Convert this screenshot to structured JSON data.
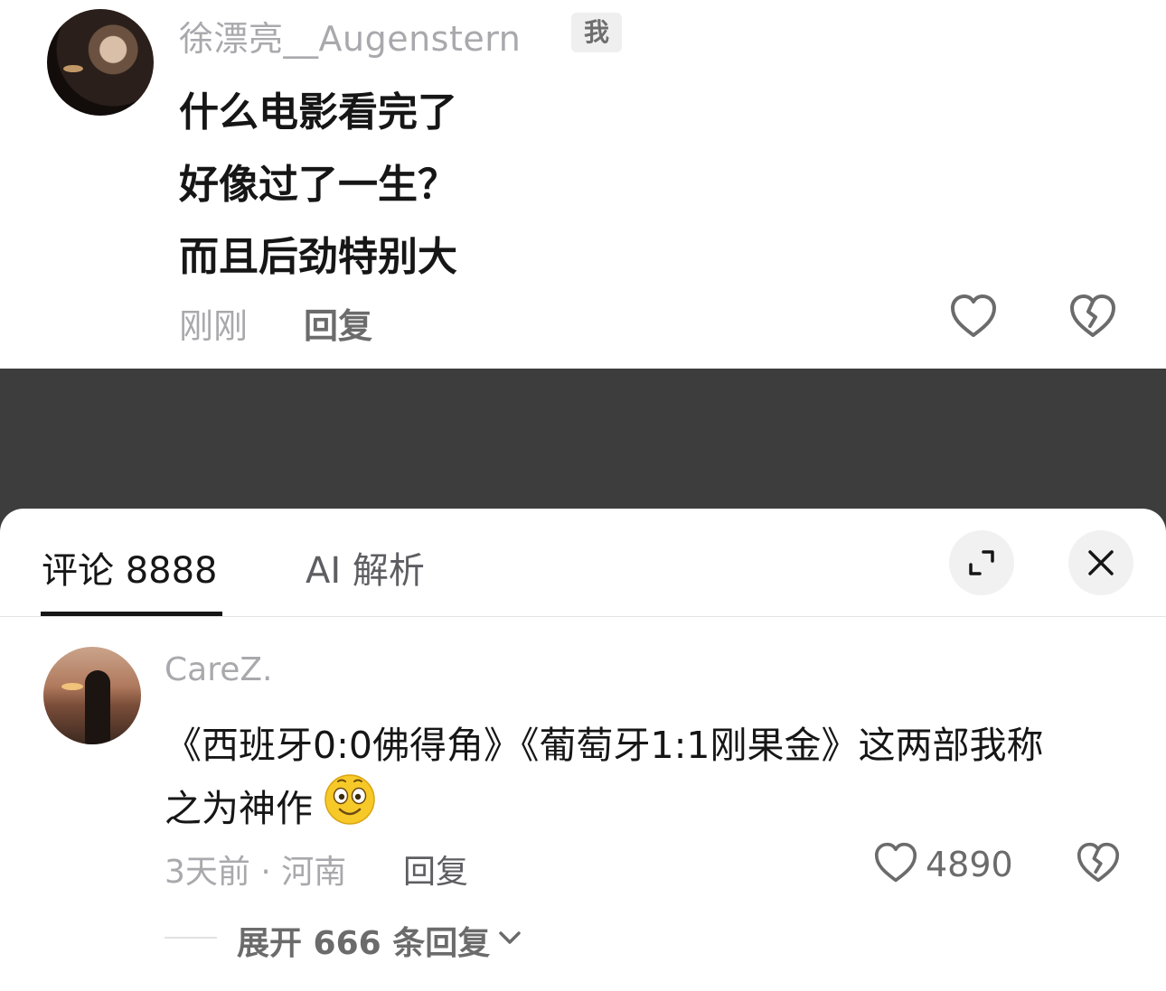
{
  "top_comment": {
    "username": "徐漂亮__Augenstern",
    "badge": "我",
    "lines": [
      "什么电影看完了",
      "好像过了一生？",
      "而且后劲特别大"
    ],
    "time": "刚刚",
    "reply_label": "回复"
  },
  "sheet": {
    "tabs": [
      {
        "label": "评论 8888",
        "active": true
      },
      {
        "label": "AI 解析",
        "active": false
      }
    ],
    "icons": {
      "expand": "expand-icon",
      "close": "close-icon"
    }
  },
  "comment": {
    "username": "CareZ.",
    "text_line1": "《西班牙0:0佛得角》《葡萄牙1:1刚果金》这两部我称",
    "text_line2": "之为神作",
    "emoji": "smiley-emoji",
    "meta": "3天前 · 河南",
    "reply_label": "回复",
    "likes": "4890",
    "expand_label": "展开 666 条回复"
  },
  "colors": {
    "text_primary": "#161616",
    "text_secondary": "#a9a9ad",
    "overlay": "#3d3d3d",
    "sheet": "#ffffff"
  }
}
